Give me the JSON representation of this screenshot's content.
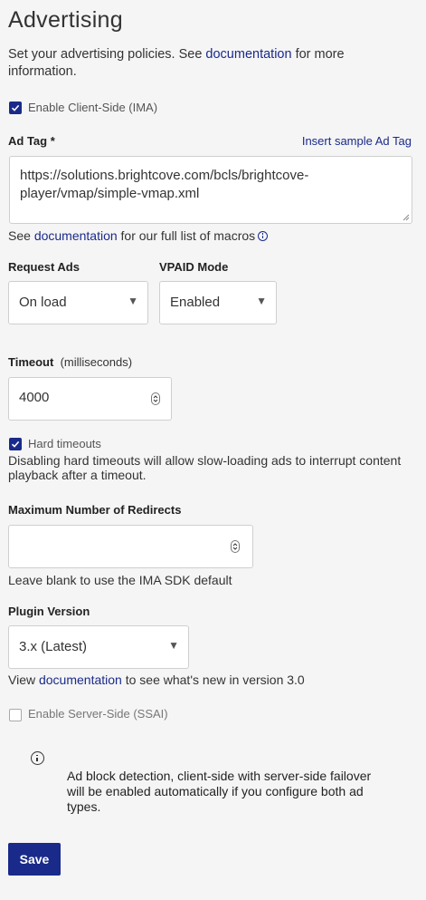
{
  "page": {
    "title": "Advertising",
    "intro_before": "Set your advertising policies. See ",
    "intro_link": "documentation",
    "intro_after": " for more information."
  },
  "client_side": {
    "label": "Enable Client-Side (IMA)",
    "checked": true
  },
  "ad_tag": {
    "label": "Ad Tag *",
    "insert_sample": "Insert sample Ad Tag",
    "value": "https://solutions.brightcove.com/bcls/brightcove-player/vmap/simple-vmap.xml",
    "help_before": "See ",
    "help_link": "documentation",
    "help_after": " for our full list of macros"
  },
  "request_ads": {
    "label": "Request Ads",
    "value": "On load"
  },
  "vpaid_mode": {
    "label": "VPAID Mode",
    "value": "Enabled"
  },
  "timeout": {
    "label": "Timeout",
    "unit": "(milliseconds)",
    "value": "4000"
  },
  "hard_timeouts": {
    "label": "Hard timeouts",
    "checked": true,
    "description": "Disabling hard timeouts will allow slow-loading ads to interrupt content playback after a timeout."
  },
  "max_redirects": {
    "label": "Maximum Number of Redirects",
    "value": "",
    "help": "Leave blank to use the IMA SDK default"
  },
  "plugin_version": {
    "label": "Plugin Version",
    "value": "3.x (Latest)",
    "help_before": "View ",
    "help_link": "documentation",
    "help_after": " to see what's new in version 3.0"
  },
  "server_side": {
    "label": "Enable Server-Side (SSAI)",
    "checked": false
  },
  "notice": {
    "text": "Ad block detection, client-side with server-side failover will be enabled automatically if you configure both ad types."
  },
  "save": {
    "label": "Save"
  },
  "colors": {
    "accent": "#1a2a8a",
    "background": "#f5f5f5"
  },
  "icons": [
    "check-icon",
    "info-icon",
    "dropdown-arrow-icon",
    "spinner-icon"
  ]
}
